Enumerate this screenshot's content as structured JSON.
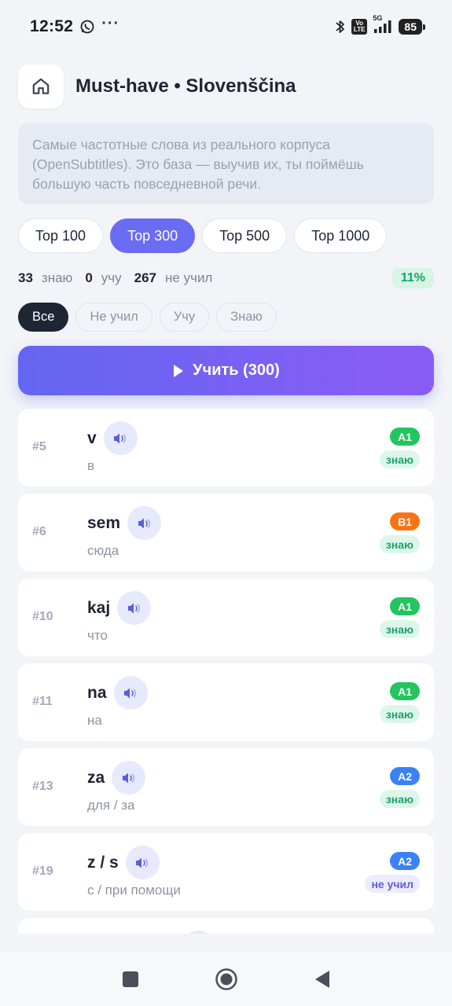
{
  "status_bar": {
    "time": "12:52",
    "dots": "···",
    "network": "5G",
    "volte_line1": "Vo",
    "volte_line2": "LTE",
    "battery": "85"
  },
  "header": {
    "title": "Must-have • Slovenščina",
    "home_icon": "home-icon"
  },
  "description": "Самые частотные слова из реального корпуса (OpenSubtitles). Это база — выучив их, ты поймёшь большую часть повседневной речи.",
  "top_tabs": [
    {
      "label": "Top 100",
      "active": false
    },
    {
      "label": "Top 300",
      "active": true
    },
    {
      "label": "Top 500",
      "active": false
    },
    {
      "label": "Top 1000",
      "active": false
    }
  ],
  "stats": {
    "known_count": "33",
    "known_label": "знаю",
    "learning_count": "0",
    "learning_label": "учу",
    "new_count": "267",
    "new_label": "не учил",
    "progress": "11%"
  },
  "filters": [
    {
      "label": "Все",
      "active": true
    },
    {
      "label": "Не учил",
      "active": false
    },
    {
      "label": "Учу",
      "active": false
    },
    {
      "label": "Знаю",
      "active": false
    }
  ],
  "study_button": {
    "label": "Учить (300)"
  },
  "words": [
    {
      "rank": "#5",
      "word": "v",
      "translation": "в",
      "level": "A1",
      "state": "знаю",
      "state_type": "known"
    },
    {
      "rank": "#6",
      "word": "sem",
      "translation": "сюда",
      "level": "B1",
      "state": "знаю",
      "state_type": "known"
    },
    {
      "rank": "#10",
      "word": "kaj",
      "translation": "что",
      "level": "A1",
      "state": "знаю",
      "state_type": "known"
    },
    {
      "rank": "#11",
      "word": "na",
      "translation": "на",
      "level": "A1",
      "state": "знаю",
      "state_type": "known"
    },
    {
      "rank": "#13",
      "word": "za",
      "translation": "для / за",
      "level": "A2",
      "state": "знаю",
      "state_type": "known"
    },
    {
      "rank": "#19",
      "word": "z / s",
      "translation": "с / при помощи",
      "level": "A2",
      "state": "не учил",
      "state_type": "new"
    }
  ],
  "colors": {
    "accent": "#6a6cf3",
    "gradient_start": "#6366f1",
    "gradient_end": "#8b5cf6",
    "known": "#1ea06a",
    "level_A1": "#22c55e",
    "level_A2": "#3b82f6",
    "level_B1": "#f97316"
  }
}
